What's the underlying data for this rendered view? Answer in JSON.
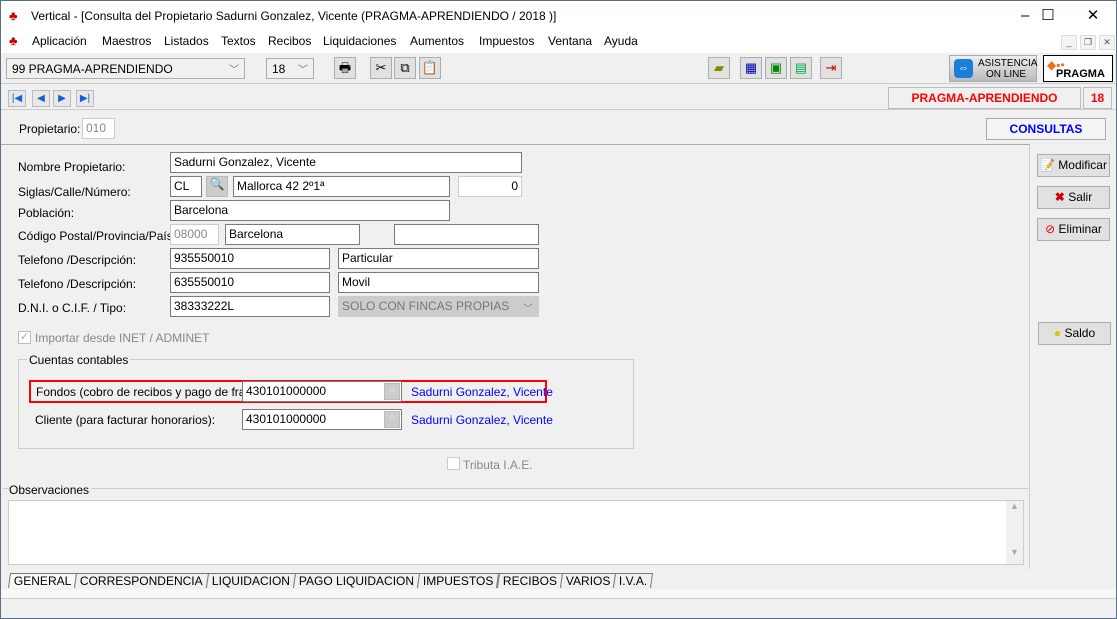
{
  "window": {
    "title": "Vertical - [Consulta del Propietario Sadurni Gonzalez, Vicente (PRAGMA-APRENDIENDO / 2018 )]",
    "minimize": "–",
    "maximize": "☐",
    "close": "✕"
  },
  "menu": [
    "Aplicación",
    "Maestros",
    "Listados",
    "Textos",
    "Recibos",
    "Liquidaciones",
    "Aumentos",
    "Impuestos",
    "Ventana",
    "Ayuda"
  ],
  "toolbar": {
    "company": "99  PRAGMA-APRENDIENDO",
    "year": "18",
    "assist_line1": "ASISTENCIA",
    "assist_line2": "ON LINE",
    "brand": "PRAGMA"
  },
  "status": {
    "company": "PRAGMA-APRENDIENDO",
    "year": "18"
  },
  "header": {
    "owner_label": "Propietario:",
    "owner_code": "010",
    "mode": "CONSULTAS"
  },
  "form": {
    "name_label": "Nombre Propietario:",
    "name": "Sadurni Gonzalez, Vicente",
    "street_label": "Siglas/Calle/Número:",
    "siglas": "CL",
    "street": "Mallorca 42 2º1ª",
    "number": "0",
    "city_label": "Población:",
    "city": "Barcelona",
    "postal_label": "Código Postal/Provincia/País:",
    "postal": "08000",
    "province": "Barcelona",
    "country": "",
    "phone1_label": "Telefono /Descripción:",
    "phone1": "935550010",
    "phone1_desc": "Particular",
    "phone2_label": "Telefono /Descripción:",
    "phone2": "635550010",
    "phone2_desc": "Movil",
    "dni_label": "D.N.I. o C.I.F. / Tipo:",
    "dni": "38333222L",
    "tipo": "SOLO CON FINCAS PROPIAS",
    "import_label": "Importar desde INET / ADMINET",
    "accounts_title": "Cuentas contables",
    "fondos_label": "Fondos (cobro de recibos y pago de fras.):",
    "fondos": "430101000000",
    "fondos_name": "Sadurni Gonzalez, Vicente",
    "cliente_label": "Cliente (para facturar honorarios):",
    "cliente": "430101000000",
    "cliente_name": "Sadurni Gonzalez, Vicente",
    "iae_label": "Tributa I.A.E.",
    "obs_label": "Observaciones",
    "obs": ""
  },
  "actions": {
    "modify": "Modificar",
    "exit": "Salir",
    "delete": "Eliminar",
    "balance": "Saldo"
  },
  "tabs": [
    "GENERAL",
    "CORRESPONDENCIA",
    "LIQUIDACION",
    "PAGO LIQUIDACION",
    "IMPUESTOS",
    "RECIBOS",
    "VARIOS",
    "I.V.A."
  ],
  "colors": {
    "highlight": "#ff0000",
    "status_text": "#ff0000",
    "mode_text": "#0000ff",
    "link": "#0000ff"
  }
}
